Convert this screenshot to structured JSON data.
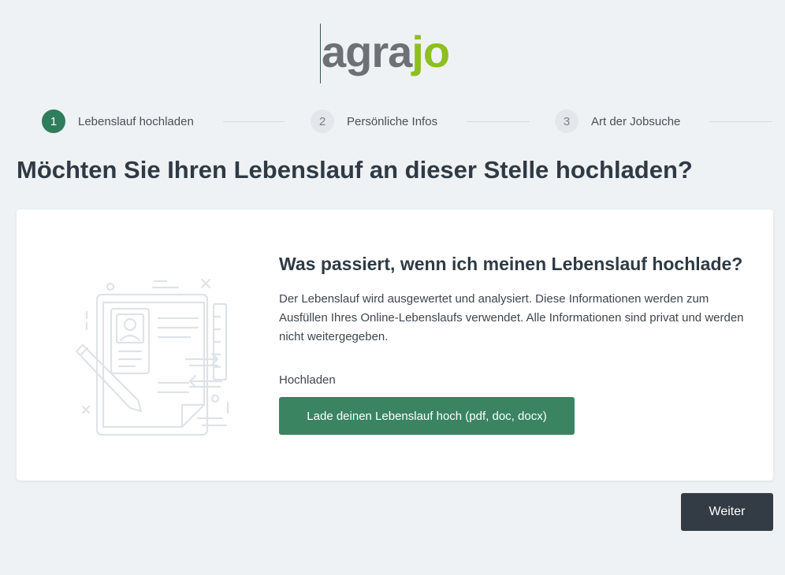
{
  "logo": {
    "part1": "agra",
    "part2": "jo"
  },
  "steps": [
    {
      "num": "1",
      "label": "Lebenslauf hochladen",
      "active": true
    },
    {
      "num": "2",
      "label": "Persönliche Infos",
      "active": false
    },
    {
      "num": "3",
      "label": "Art der Jobsuche",
      "active": false
    }
  ],
  "page_title": "Möchten Sie Ihren Lebenslauf an dieser Stelle hochladen?",
  "card": {
    "heading": "Was passiert, wenn ich meinen Lebenslauf hochlade?",
    "description": "Der Lebenslauf wird ausgewertet und analysiert. Diese Informationen werden zum Ausfüllen Ihres Online-Lebenslaufs verwendet. Alle Informationen sind privat und werden nicht weitergegeben.",
    "upload_label": "Hochladen",
    "upload_button": "Lade deinen Lebenslauf hoch (pdf, doc, docx)",
    "illustration_icon": "resume-upload-illustration"
  },
  "next_button": "Weiter",
  "colors": {
    "accent": "#2f7d5a",
    "button_green": "#3a8462",
    "button_dark": "#333b44",
    "logo_gray": "#6d7074",
    "logo_green": "#8cbf1f"
  }
}
